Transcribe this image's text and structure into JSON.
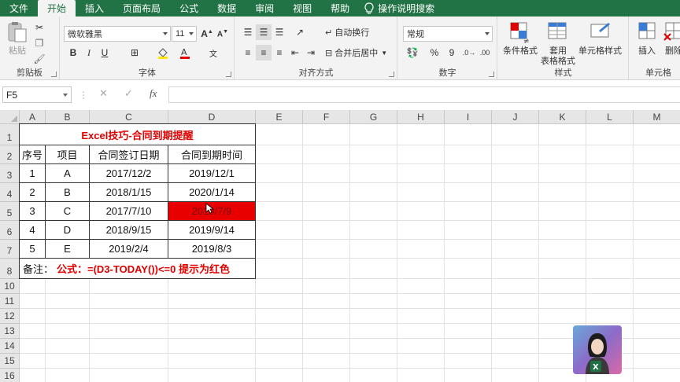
{
  "ribbon_tabs": [
    "文件",
    "开始",
    "插入",
    "页面布局",
    "公式",
    "数据",
    "审阅",
    "视图",
    "帮助"
  ],
  "tell_me": "操作说明搜索",
  "clipboard": {
    "paste": "粘贴",
    "label": "剪贴板"
  },
  "font": {
    "name": "微软雅黑",
    "size": "11",
    "label": "字体",
    "bold": "B",
    "italic": "I",
    "underline": "U",
    "wen": "文"
  },
  "alignment": {
    "wrap": "自动换行",
    "merge": "合并后居中",
    "label": "对齐方式"
  },
  "number": {
    "format": "常规",
    "percent": "%",
    "comma": "9",
    "label": "数字"
  },
  "styles": {
    "conditional": "条件格式",
    "table_line1": "套用",
    "table_line2": "表格格式",
    "cell_styles": "单元格样式",
    "label": "样式"
  },
  "cells": {
    "insert": "插入",
    "delete": "删除",
    "label": "单元格"
  },
  "formula_bar": {
    "name_box": "F5",
    "fx": "fx",
    "value": ""
  },
  "columns": [
    "A",
    "B",
    "C",
    "D",
    "E",
    "F",
    "G",
    "H",
    "I",
    "J",
    "K",
    "L",
    "M"
  ],
  "rows": [
    "1",
    "2",
    "3",
    "4",
    "5",
    "6",
    "7",
    "8",
    "10",
    "11",
    "12",
    "13",
    "14",
    "15",
    "16"
  ],
  "sheet": {
    "title": "Excel技巧-合同到期提醒",
    "headers": [
      "序号",
      "项目",
      "合同签订日期",
      "合同到期时间"
    ],
    "data": [
      [
        "1",
        "A",
        "2017/12/2",
        "2019/12/1"
      ],
      [
        "2",
        "B",
        "2018/1/15",
        "2020/1/14"
      ],
      [
        "3",
        "C",
        "2017/7/10",
        "2019/7/9"
      ],
      [
        "4",
        "D",
        "2018/9/15",
        "2019/9/14"
      ],
      [
        "5",
        "E",
        "2019/2/4",
        "2019/8/3"
      ]
    ],
    "note_label": "备注：",
    "note_formula": "公式：=(D3-TODAY())<=0  提示为红色"
  },
  "colors": {
    "ribbon": "#217346",
    "highlight": "#e80000",
    "title": "#e00000"
  }
}
